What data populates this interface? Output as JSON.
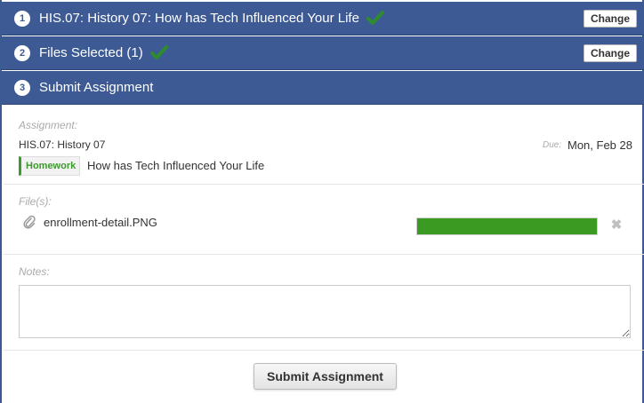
{
  "steps": [
    {
      "number": "1",
      "title": "HIS.07: History 07: How has Tech Influenced Your Life",
      "completed": true,
      "change_label": "Change"
    },
    {
      "number": "2",
      "title": "Files Selected (1)",
      "completed": true,
      "change_label": "Change"
    },
    {
      "number": "3",
      "title": "Submit Assignment",
      "completed": false
    }
  ],
  "assignment": {
    "label": "Assignment:",
    "course": "HIS.07: History 07",
    "due_label": "Due:",
    "due_date": "Mon, Feb 28",
    "type_badge": "Homework",
    "name": "How has Tech Influenced Your Life"
  },
  "files": {
    "label": "File(s):",
    "items": [
      {
        "icon": "paperclip-icon",
        "name": "enrollment-detail.PNG",
        "upload_progress": 1.0,
        "remove_icon": "close-icon"
      }
    ]
  },
  "notes": {
    "label": "Notes:",
    "value": "",
    "placeholder": ""
  },
  "submit": {
    "label": "Submit Assignment"
  },
  "colors": {
    "header_bg": "#3d5a94",
    "check": "#2e8b2e",
    "progress": "#3a9a22",
    "badge": "#3d9a2e"
  }
}
